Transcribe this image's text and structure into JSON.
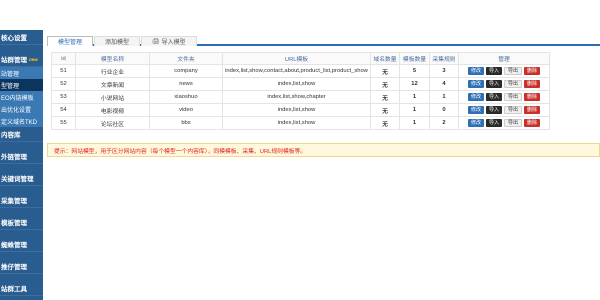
{
  "sidebar": {
    "items": [
      {
        "label": "核心设置",
        "kind": "group"
      },
      {
        "label": "站群管理",
        "kind": "group",
        "badge": "new"
      },
      {
        "label": "站管理",
        "kind": "sub"
      },
      {
        "label": "型管理",
        "kind": "sub",
        "active": true
      },
      {
        "label": "EO内链模板",
        "kind": "sub"
      },
      {
        "label": "出优化设置",
        "kind": "sub"
      },
      {
        "label": "定义域名TKD",
        "kind": "sub"
      },
      {
        "label": "内容库",
        "kind": "group"
      },
      {
        "label": "外链管理",
        "kind": "group"
      },
      {
        "label": "关键词管理",
        "kind": "group"
      },
      {
        "label": "采集管理",
        "kind": "group"
      },
      {
        "label": "模板管理",
        "kind": "group"
      },
      {
        "label": "蜘蛛管理",
        "kind": "group"
      },
      {
        "label": "推仔管理",
        "kind": "group"
      },
      {
        "label": "站群工具",
        "kind": "group"
      }
    ]
  },
  "tabs": [
    {
      "label": "模型管理",
      "active": true,
      "icon": ""
    },
    {
      "label": "添加模型",
      "active": false,
      "icon": ""
    },
    {
      "label": "导入模型",
      "active": false,
      "icon": "printer-icon"
    }
  ],
  "table": {
    "headers": [
      "id",
      "模型名称",
      "文件夹",
      "URL模板",
      "域名数量",
      "模板数量",
      "采集规则",
      "管理"
    ],
    "rows": [
      {
        "id": "51",
        "name": "行业企业",
        "dir": "company",
        "url": "index,list,show,contact,about,product_list,product_show",
        "domains": "无",
        "templates": "5",
        "rules": "3"
      },
      {
        "id": "52",
        "name": "文章新闻",
        "dir": "news",
        "url": "index,list,show",
        "domains": "无",
        "templates": "12",
        "rules": "4"
      },
      {
        "id": "53",
        "name": "小说网站",
        "dir": "xiaoshuo",
        "url": "index,list,show,chapter",
        "domains": "无",
        "templates": "1",
        "rules": "1"
      },
      {
        "id": "54",
        "name": "电影视频",
        "dir": "video",
        "url": "index,list,show",
        "domains": "无",
        "templates": "1",
        "rules": "0"
      },
      {
        "id": "55",
        "name": "论坛社区",
        "dir": "bbs",
        "url": "index,list,show",
        "domains": "无",
        "templates": "1",
        "rules": "2"
      }
    ],
    "actions": {
      "edit": "修改",
      "import": "导入",
      "export": "导出",
      "delete": "删除"
    }
  },
  "notice": "提示：网站模型，用于区分网站内容（每个模型一个内容库），同模模板、采集、URL规则模板等。",
  "colors": {
    "sidebar": "#2a5d8f",
    "accent": "#2d6eb3",
    "danger": "#c9302c",
    "success": "#1e9e1e"
  }
}
